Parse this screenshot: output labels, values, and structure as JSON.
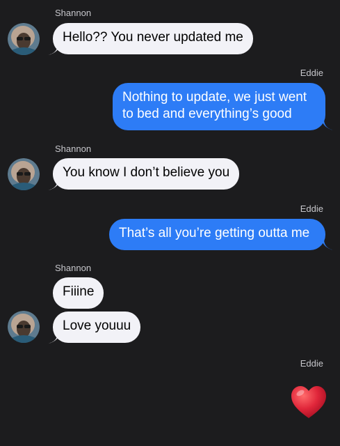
{
  "messages": [
    {
      "sender": "Shannon",
      "text": "Hello?? You never updated me"
    },
    {
      "sender": "Eddie",
      "text": "Nothing to update, we just went to bed and everything’s good"
    },
    {
      "sender": "Shannon",
      "text": "You know I don’t believe you"
    },
    {
      "sender": "Eddie",
      "text": "That’s all you’re getting outta me"
    },
    {
      "sender": "Shannon",
      "text": "Fiiine"
    },
    {
      "sender": "Shannon",
      "text": "Love youuu"
    },
    {
      "sender": "Eddie",
      "text": "",
      "emoji": "heart"
    }
  ],
  "colors": {
    "background": "#1c1c1e",
    "incoming_bubble": "#f2f2f7",
    "outgoing_bubble": "#2d7cf6",
    "heart": "#e0263a"
  },
  "icons": {
    "avatar": "contact-photo-icon",
    "reaction": "red-heart-icon"
  }
}
